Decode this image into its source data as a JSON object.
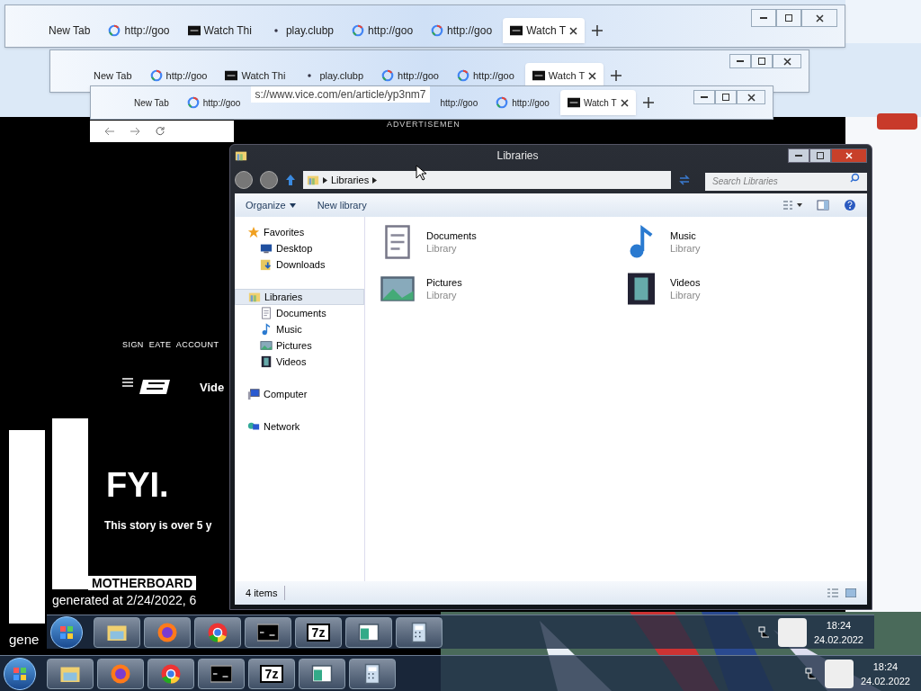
{
  "browser_windows": [
    {
      "tabs": [
        {
          "label": "New Tab",
          "kind": "blank",
          "selected": false
        },
        {
          "label": "http://goo",
          "kind": "google",
          "selected": false
        },
        {
          "label": "Watch Thi",
          "kind": "video",
          "selected": false
        },
        {
          "label": "play.clubp",
          "kind": "loading",
          "selected": false
        },
        {
          "label": "http://goo",
          "kind": "google",
          "selected": false
        },
        {
          "label": "http://goo",
          "kind": "google",
          "selected": false
        },
        {
          "label": "Watch T",
          "kind": "video",
          "selected": true
        }
      ]
    },
    {
      "tabs": [
        {
          "label": "New Tab",
          "kind": "blank",
          "selected": false
        },
        {
          "label": "http://goo",
          "kind": "google",
          "selected": false
        },
        {
          "label": "Watch Thi",
          "kind": "video",
          "selected": false
        },
        {
          "label": "play.clubp",
          "kind": "loading",
          "selected": false
        },
        {
          "label": "http://goo",
          "kind": "google",
          "selected": false
        },
        {
          "label": "http://goo",
          "kind": "google",
          "selected": false
        },
        {
          "label": "Watch T",
          "kind": "video",
          "selected": true
        }
      ]
    },
    {
      "tabs": [
        {
          "label": "New Tab",
          "kind": "blank",
          "selected": false
        },
        {
          "label": "http://goo",
          "kind": "google",
          "selected": false
        },
        {
          "label": "http://goo",
          "kind": "blank",
          "selected": false
        },
        {
          "label": "http://goo",
          "kind": "google",
          "selected": false
        },
        {
          "label": "Watch T",
          "kind": "video",
          "selected": true
        }
      ],
      "url": "s://www.vice.com/en/article/yp3nm7",
      "banner": "ADVERTISEMEN"
    }
  ],
  "web_page": {
    "account_links": "SIGN  EATE  ACCOUNT",
    "nav_item": "Vide",
    "headline": "FYI.",
    "notice": "This story is over 5 y",
    "section": "MOTHERBOARD",
    "footer": "generated at 2/24/2022, 6",
    "footer_trail": "gene"
  },
  "explorer": {
    "title": "Libraries",
    "breadcrumb": "Libraries",
    "search_placeholder": "Search Libraries",
    "toolbar": [
      "Organize",
      "New library"
    ],
    "nav": [
      {
        "label": "Favorites",
        "kind": "star",
        "selected": false,
        "children": [
          {
            "label": "Desktop",
            "kind": "desktop",
            "selected": false
          },
          {
            "label": "Downloads",
            "kind": "downloads",
            "selected": false
          }
        ]
      },
      {
        "label": "Libraries",
        "kind": "libraries",
        "selected": true,
        "children": [
          {
            "label": "Documents",
            "kind": "documents",
            "selected": false
          },
          {
            "label": "Music",
            "kind": "music",
            "selected": false
          },
          {
            "label": "Pictures",
            "kind": "pictures",
            "selected": false
          },
          {
            "label": "Videos",
            "kind": "videos",
            "selected": false
          }
        ]
      },
      {
        "label": "Computer",
        "kind": "computer",
        "selected": false
      },
      {
        "label": "Network",
        "kind": "network",
        "selected": false
      }
    ],
    "items": [
      {
        "name": "Documents",
        "type": "Library",
        "kind": "documents"
      },
      {
        "name": "Music",
        "type": "Library",
        "kind": "music"
      },
      {
        "name": "Pictures",
        "type": "Library",
        "kind": "pictures"
      },
      {
        "name": "Videos",
        "type": "Library",
        "kind": "videos"
      }
    ],
    "status": "4 items"
  },
  "taskbars": [
    {
      "apps": [
        {
          "kind": "explorer"
        },
        {
          "kind": "firefox"
        },
        {
          "kind": "chrome"
        },
        {
          "kind": "terminal"
        },
        {
          "kind": "archiver",
          "label": "7z"
        },
        {
          "kind": "window"
        },
        {
          "kind": "calculator"
        }
      ],
      "time": "18:24",
      "date": "24.02.2022"
    },
    {
      "apps": [
        {
          "kind": "explorer"
        },
        {
          "kind": "firefox"
        },
        {
          "kind": "chrome"
        },
        {
          "kind": "terminal"
        },
        {
          "kind": "archiver",
          "label": "7z"
        },
        {
          "kind": "window"
        },
        {
          "kind": "calculator"
        }
      ],
      "time": "18:24",
      "date": "24.02.2022"
    }
  ]
}
